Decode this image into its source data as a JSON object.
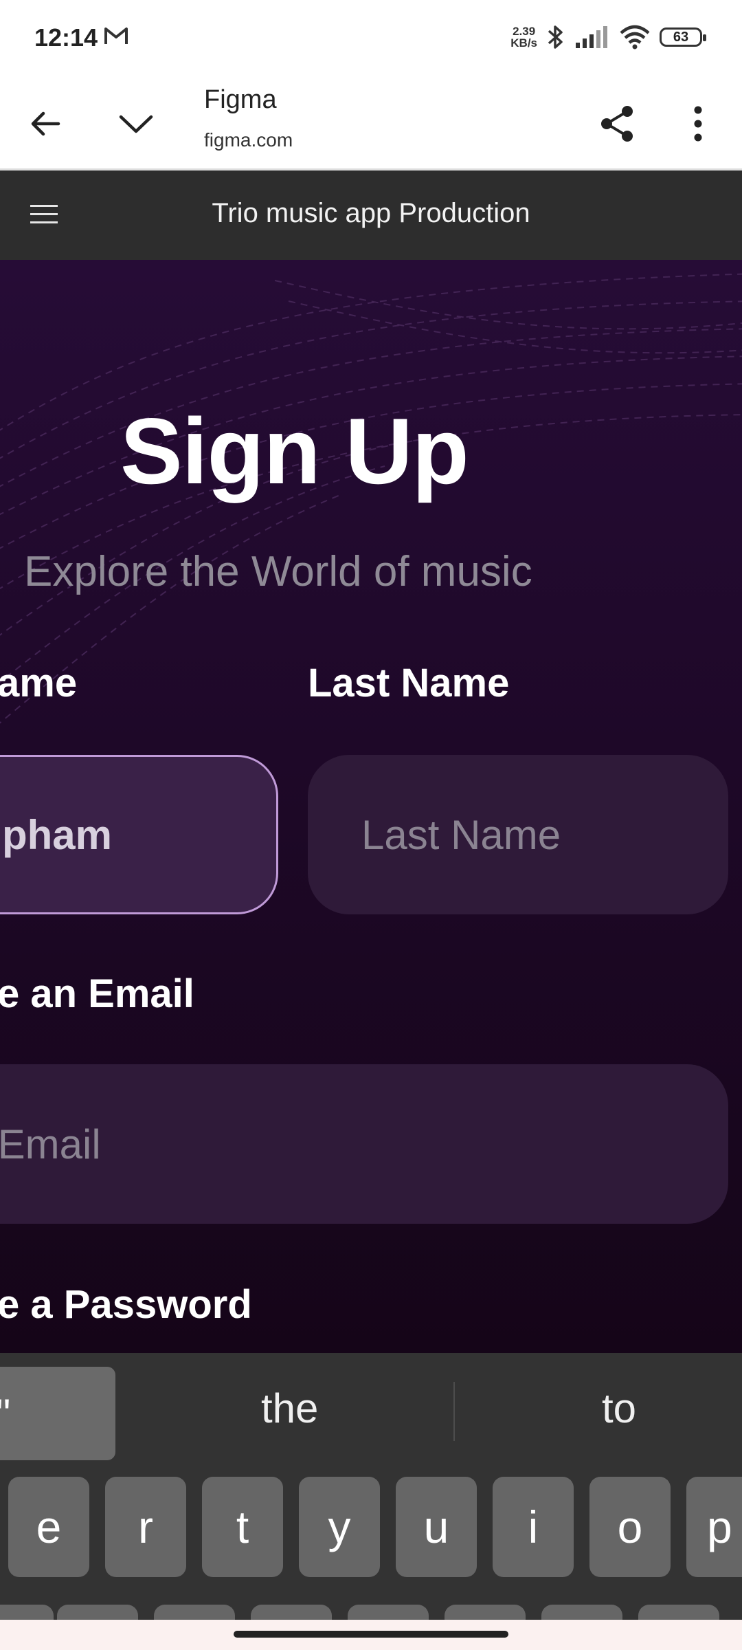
{
  "status_bar": {
    "time": "12:14",
    "net_speed_value": "2.39",
    "net_speed_unit": "KB/s",
    "battery": "63"
  },
  "browser": {
    "title": "Figma",
    "url": "figma.com"
  },
  "figma": {
    "file_title": "Trio music app Production"
  },
  "signup": {
    "heading": "Sign Up",
    "subheading": "Explore the World of music",
    "first_name_label": "ame",
    "first_name_value": "pham",
    "last_name_label": "Last Name",
    "last_name_placeholder": "Last Name",
    "email_label": "e an Email",
    "email_placeholder": "r Email",
    "password_label": "e a Password"
  },
  "keyboard": {
    "suggestion_chip": "\"",
    "suggestions": [
      "the",
      "to"
    ],
    "row1": [
      "e",
      "r",
      "t",
      "y",
      "u",
      "i",
      "o",
      "p"
    ]
  }
}
